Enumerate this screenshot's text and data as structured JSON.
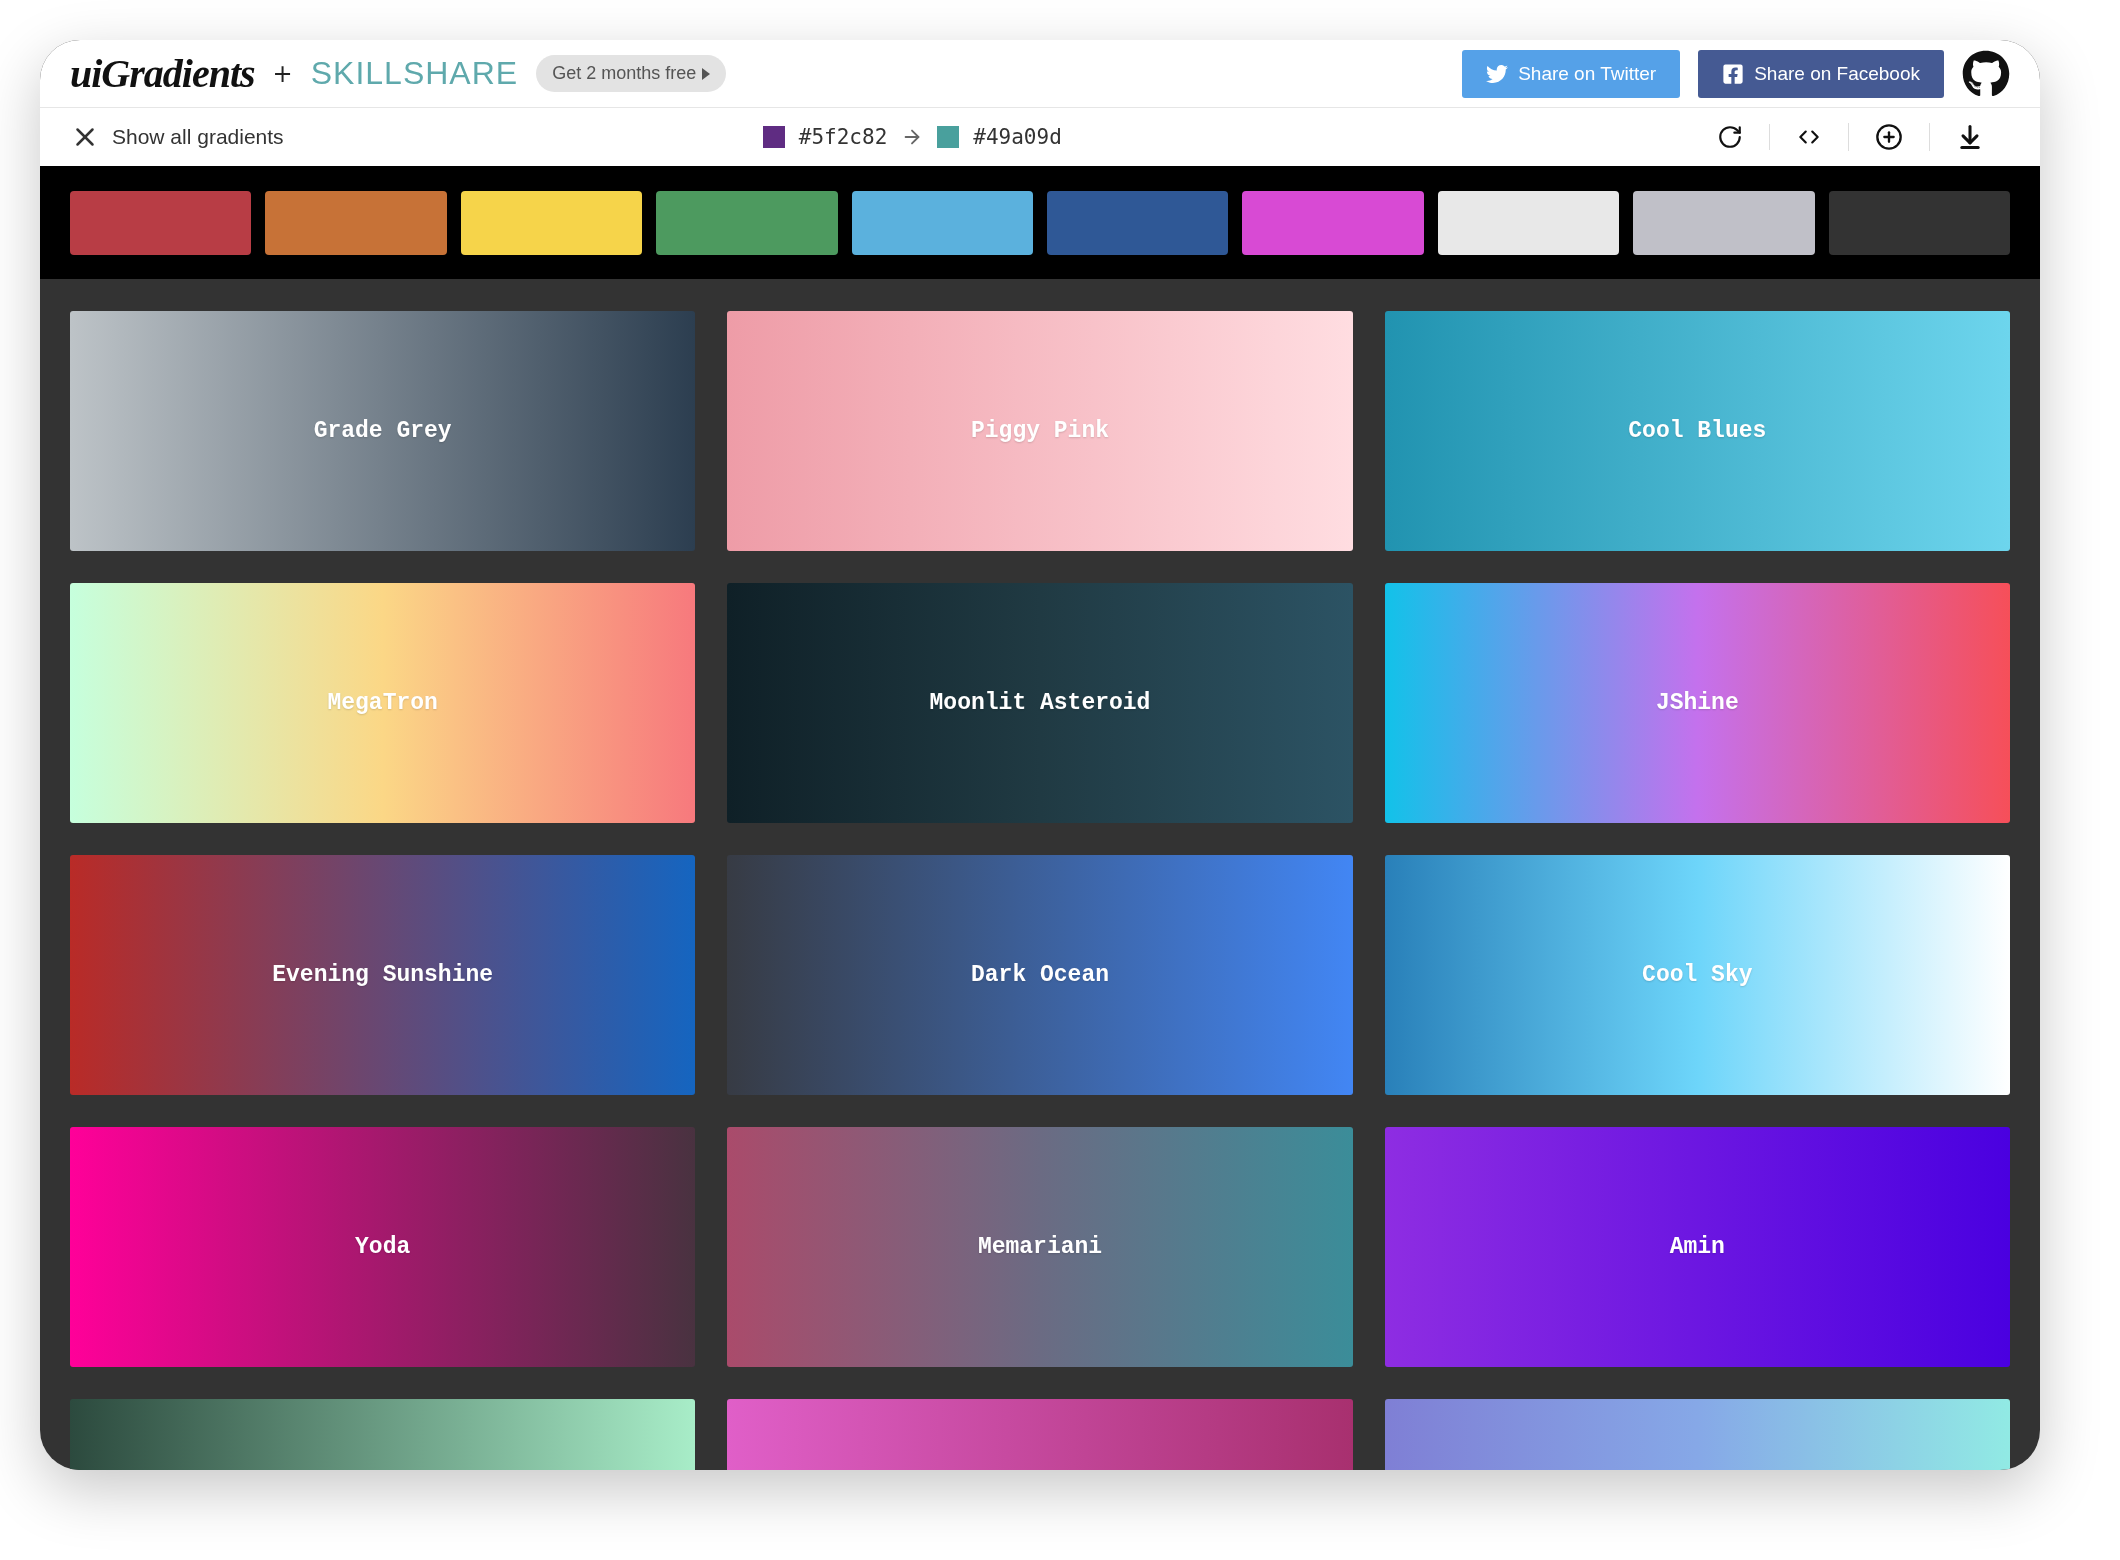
{
  "header": {
    "logo": "uiGradients",
    "plus": "+",
    "partner": "SKILLSHARE",
    "promo": "Get 2 months free",
    "share_buttons": [
      {
        "kind": "twitter",
        "label": "Share on Twitter"
      },
      {
        "kind": "facebook",
        "label": "Share on Facebook"
      }
    ]
  },
  "toolbar": {
    "back_label": "Show all gradients",
    "from": {
      "hex": "#5f2c82",
      "color": "#5f2c82"
    },
    "to": {
      "hex": "#49a09d",
      "color": "#49a09d"
    }
  },
  "color_filters": [
    {
      "color": "#b83d45"
    },
    {
      "color": "#c77237"
    },
    {
      "color": "#f6d44a"
    },
    {
      "color": "#4d9a5f"
    },
    {
      "color": "#5bb1dd"
    },
    {
      "color": "#2f5896"
    },
    {
      "color": "#d84ad4"
    },
    {
      "color": "#e8e8e8"
    },
    {
      "color": "#c0c0c8"
    },
    {
      "color": "#333333"
    }
  ],
  "gradients": [
    {
      "name": "Grade Grey",
      "stops": [
        {
          "color": "#bdc3c7"
        },
        {
          "color": "#2c3e50"
        }
      ]
    },
    {
      "name": "Piggy Pink",
      "stops": [
        {
          "color": "#ee9ca7"
        },
        {
          "color": "#ffdde1"
        }
      ]
    },
    {
      "name": "Cool Blues",
      "stops": [
        {
          "color": "#2193b0"
        },
        {
          "color": "#6dd5ed"
        }
      ]
    },
    {
      "name": "MegaTron",
      "stops": [
        {
          "color": "#c6ffdd"
        },
        {
          "color": "#fbd786"
        },
        {
          "color": "#f7797d"
        }
      ]
    },
    {
      "name": "Moonlit Asteroid",
      "stops": [
        {
          "color": "#0f2027"
        },
        {
          "color": "#203a43"
        },
        {
          "color": "#2c5364"
        }
      ]
    },
    {
      "name": "JShine",
      "stops": [
        {
          "color": "#12c2e9"
        },
        {
          "color": "#c471ed"
        },
        {
          "color": "#f64f59"
        }
      ]
    },
    {
      "name": "Evening Sunshine",
      "stops": [
        {
          "color": "#b92b27"
        },
        {
          "color": "#1565c0"
        }
      ]
    },
    {
      "name": "Dark Ocean",
      "stops": [
        {
          "color": "#373b44"
        },
        {
          "color": "#4286f4"
        }
      ]
    },
    {
      "name": "Cool Sky",
      "stops": [
        {
          "color": "#2980b9"
        },
        {
          "color": "#6dd5fa"
        },
        {
          "color": "#ffffff"
        }
      ]
    },
    {
      "name": "Yoda",
      "stops": [
        {
          "color": "#ff0099"
        },
        {
          "color": "#493240"
        }
      ]
    },
    {
      "name": "Memariani",
      "stops": [
        {
          "color": "#aa4b6b"
        },
        {
          "color": "#6b6b83"
        },
        {
          "color": "#3b8d99"
        }
      ]
    },
    {
      "name": "Amin",
      "stops": [
        {
          "color": "#8e2de2"
        },
        {
          "color": "#4a00e0"
        }
      ]
    },
    {
      "stops": [
        {
          "color": "#2c4a3e"
        },
        {
          "color": "#a8edc8"
        }
      ]
    },
    {
      "stops": [
        {
          "color": "#e05fc8"
        },
        {
          "color": "#a8306f"
        }
      ]
    },
    {
      "stops": [
        {
          "color": "#7f7fd5"
        },
        {
          "color": "#86a8e7"
        },
        {
          "color": "#91eae4"
        }
      ]
    }
  ]
}
